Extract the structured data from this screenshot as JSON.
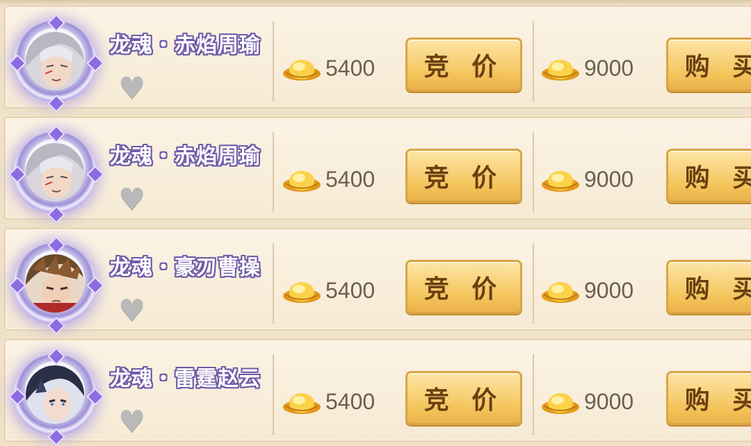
{
  "listings": [
    {
      "hero": "龙魂・赤焰周瑜",
      "bid_price": "5400",
      "bid_label": "竞 价",
      "buy_price": "9000",
      "buy_label": "购 买"
    },
    {
      "hero": "龙魂・赤焰周瑜",
      "bid_price": "5400",
      "bid_label": "竞 价",
      "buy_price": "9000",
      "buy_label": "购 买"
    },
    {
      "hero": "龙魂・豪刃曹操",
      "bid_price": "5400",
      "bid_label": "竞 价",
      "buy_price": "9000",
      "buy_label": "购 买"
    },
    {
      "hero": "龙魂・雷霆赵云",
      "bid_price": "5400",
      "bid_label": "竞 价",
      "buy_price": "9000",
      "buy_label": "购 买"
    }
  ],
  "icons": {
    "currency": "gold-ingot-icon",
    "favorite": "heart-icon"
  },
  "colors": {
    "panel": "#fbf3e4",
    "button": "#f4c45b",
    "name_outline": "#6e5aa8",
    "favorite_gray": "#b9b9b9"
  }
}
